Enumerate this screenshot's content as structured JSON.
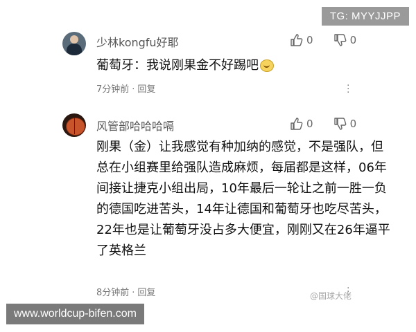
{
  "overlay": {
    "tg_label": "TG: MYYJJPP"
  },
  "comments": [
    {
      "username": "少林kongfu好耶",
      "text": "葡萄牙：我说刚果金不好踢吧",
      "likes": "0",
      "dislikes": "0",
      "time": "7分钟前",
      "reply_label": "回复"
    },
    {
      "username": "风管部哈哈哈嗝",
      "text": "刚果（金）让我感觉有种加纳的感觉，不是强队，但总在小组赛里给强队造成麻烦，每届都是这样，06年间接让捷克小组出局，10年最后一轮让之前一胜一负的德国吃进苦头，14年让德国和葡萄牙也吃尽苦头，22年也是让葡萄牙没占多大便宜，刚刚又在26年逼平了英格兰",
      "likes": "0",
      "dislikes": "0",
      "time": "8分钟前",
      "reply_label": "回复"
    }
  ],
  "footer": {
    "site_label": "www.worldcup-bifen.com",
    "watermark": "@国球大佬"
  }
}
